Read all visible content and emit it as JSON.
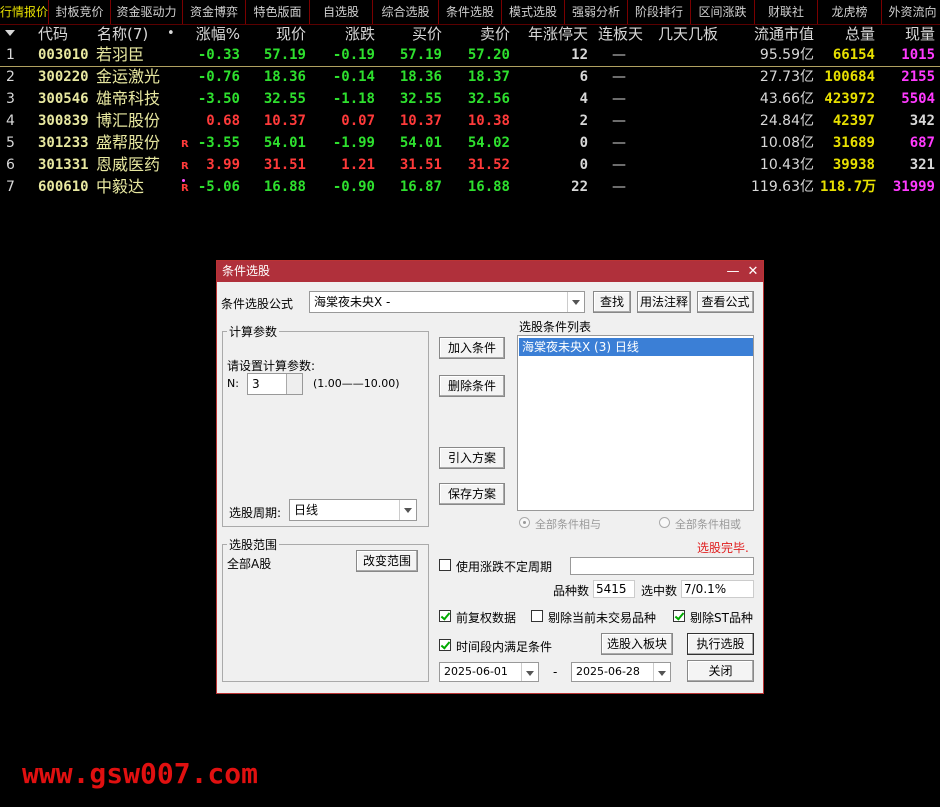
{
  "tabs": [
    "行情报价",
    "封板竞价",
    "资金驱动力",
    "资金博弈",
    "特色版面",
    "自选股",
    "综合选股",
    "条件选股",
    "模式选股",
    "强弱分析",
    "阶段排行",
    "区间涨跌",
    "财联社",
    "龙虎榜",
    "外资流向"
  ],
  "header": {
    "code": "代码",
    "name": "名称(7)",
    "dot": "•",
    "pct": "涨幅%",
    "price": "现价",
    "chg": "涨跌",
    "bid": "买价",
    "ask": "卖价",
    "yearlimit": "年涨停天",
    "board": "连板天",
    "days": "几天几板",
    "mcap": "流通市值",
    "vol": "总量",
    "cur": "现量"
  },
  "stocks": [
    {
      "idx": "1",
      "code": "003010",
      "name": "若羽臣",
      "mark": "",
      "pct": "-0.33",
      "price": "57.19",
      "chg": "-0.19",
      "bid": "57.19",
      "ask": "57.20",
      "yearlimit": "12",
      "board": "—",
      "mcap": "95.59亿",
      "vol": "66154",
      "cur": "1015",
      "dir": "dn",
      "pcol": "dn",
      "curcol": "mg"
    },
    {
      "idx": "2",
      "code": "300220",
      "name": "金运激光",
      "mark": "",
      "pct": "-0.76",
      "price": "18.36",
      "chg": "-0.14",
      "bid": "18.36",
      "ask": "18.37",
      "yearlimit": "6",
      "board": "—",
      "mcap": "27.73亿",
      "vol": "100684",
      "cur": "2155",
      "dir": "dn",
      "pcol": "dn",
      "curcol": "mg"
    },
    {
      "idx": "3",
      "code": "300546",
      "name": "雄帝科技",
      "mark": "",
      "pct": "-3.50",
      "price": "32.55",
      "chg": "-1.18",
      "bid": "32.55",
      "ask": "32.56",
      "yearlimit": "4",
      "board": "—",
      "mcap": "43.66亿",
      "vol": "423972",
      "cur": "5504",
      "dir": "dn",
      "pcol": "dn",
      "curcol": "mg"
    },
    {
      "idx": "4",
      "code": "300839",
      "name": "博汇股份",
      "mark": "",
      "pct": "0.68",
      "price": "10.37",
      "chg": "0.07",
      "bid": "10.37",
      "ask": "10.38",
      "yearlimit": "2",
      "board": "—",
      "mcap": "24.84亿",
      "vol": "42397",
      "cur": "342",
      "dir": "up",
      "pcol": "up",
      "curcol": "wh"
    },
    {
      "idx": "5",
      "code": "301233",
      "name": "盛帮股份",
      "mark": "R",
      "pct": "-3.55",
      "price": "54.01",
      "chg": "-1.99",
      "bid": "54.01",
      "ask": "54.02",
      "yearlimit": "0",
      "board": "—",
      "mcap": "10.08亿",
      "vol": "31689",
      "cur": "687",
      "dir": "dn",
      "pcol": "dn",
      "curcol": "mg"
    },
    {
      "idx": "6",
      "code": "301331",
      "name": "恩威医药",
      "mark": "R",
      "pct": "3.99",
      "price": "31.51",
      "chg": "1.21",
      "bid": "31.51",
      "ask": "31.52",
      "yearlimit": "0",
      "board": "—",
      "mcap": "10.43亿",
      "vol": "39938",
      "cur": "321",
      "dir": "up",
      "pcol": "up",
      "curcol": "wh"
    },
    {
      "idx": "7",
      "code": "600610",
      "name": "中毅达",
      "mark": "R",
      "pct": "-5.06",
      "price": "16.88",
      "chg": "-0.90",
      "bid": "16.87",
      "ask": "16.88",
      "yearlimit": "22",
      "board": "—",
      "mcap": "119.63亿",
      "vol": "118.7万",
      "cur": "31999",
      "dir": "dn",
      "pcol": "dn",
      "curcol": "mg"
    }
  ],
  "dialog": {
    "title": "条件选股",
    "minimize": "—",
    "close": "✕",
    "formula_label": "条件选股公式",
    "formula_value": "海棠夜未央X  -",
    "find_btn": "查找",
    "usage_btn": "用法注释",
    "view_btn": "查看公式",
    "params_group": "计算参数",
    "params_hint": "请设置计算参数:",
    "n_label": "N:",
    "n_value": "3",
    "n_range": "(1.00——10.00)",
    "period_label": "选股周期:",
    "period_value": "日线",
    "add_btn": "加入条件",
    "del_btn": "删除条件",
    "import_btn": "引入方案",
    "save_btn": "保存方案",
    "list_label": "选股条件列表",
    "list_items": [
      "海棠夜未央X (3) 日线"
    ],
    "radio_and": "全部条件相与",
    "radio_or": "全部条件相或",
    "status": "选股完毕.",
    "range_group": "选股范围",
    "range_value": "全部A股",
    "change_range_btn": "改变范围",
    "var_period_label": "使用涨跌不定周期",
    "count_label": "品种数",
    "count_value": "5415",
    "selected_label": "选中数",
    "selected_value": "7/0.1%",
    "fq_label": "前复权数据",
    "exclude_untraded_label": "剔除当前未交易品种",
    "exclude_st_label": "剔除ST品种",
    "time_cond_label": "时间段内满足条件",
    "to_block_btn": "选股入板块",
    "run_btn": "执行选股",
    "close_btn": "关闭",
    "date_from": "2025-06-01",
    "date_sep": "-",
    "date_to": "2025-06-28"
  },
  "watermark": "www.gsw007.com",
  "colors": {
    "up": "#ff3a3a",
    "down": "#2ee02e",
    "titlebar": "#b0303b",
    "status": "#e02020"
  }
}
